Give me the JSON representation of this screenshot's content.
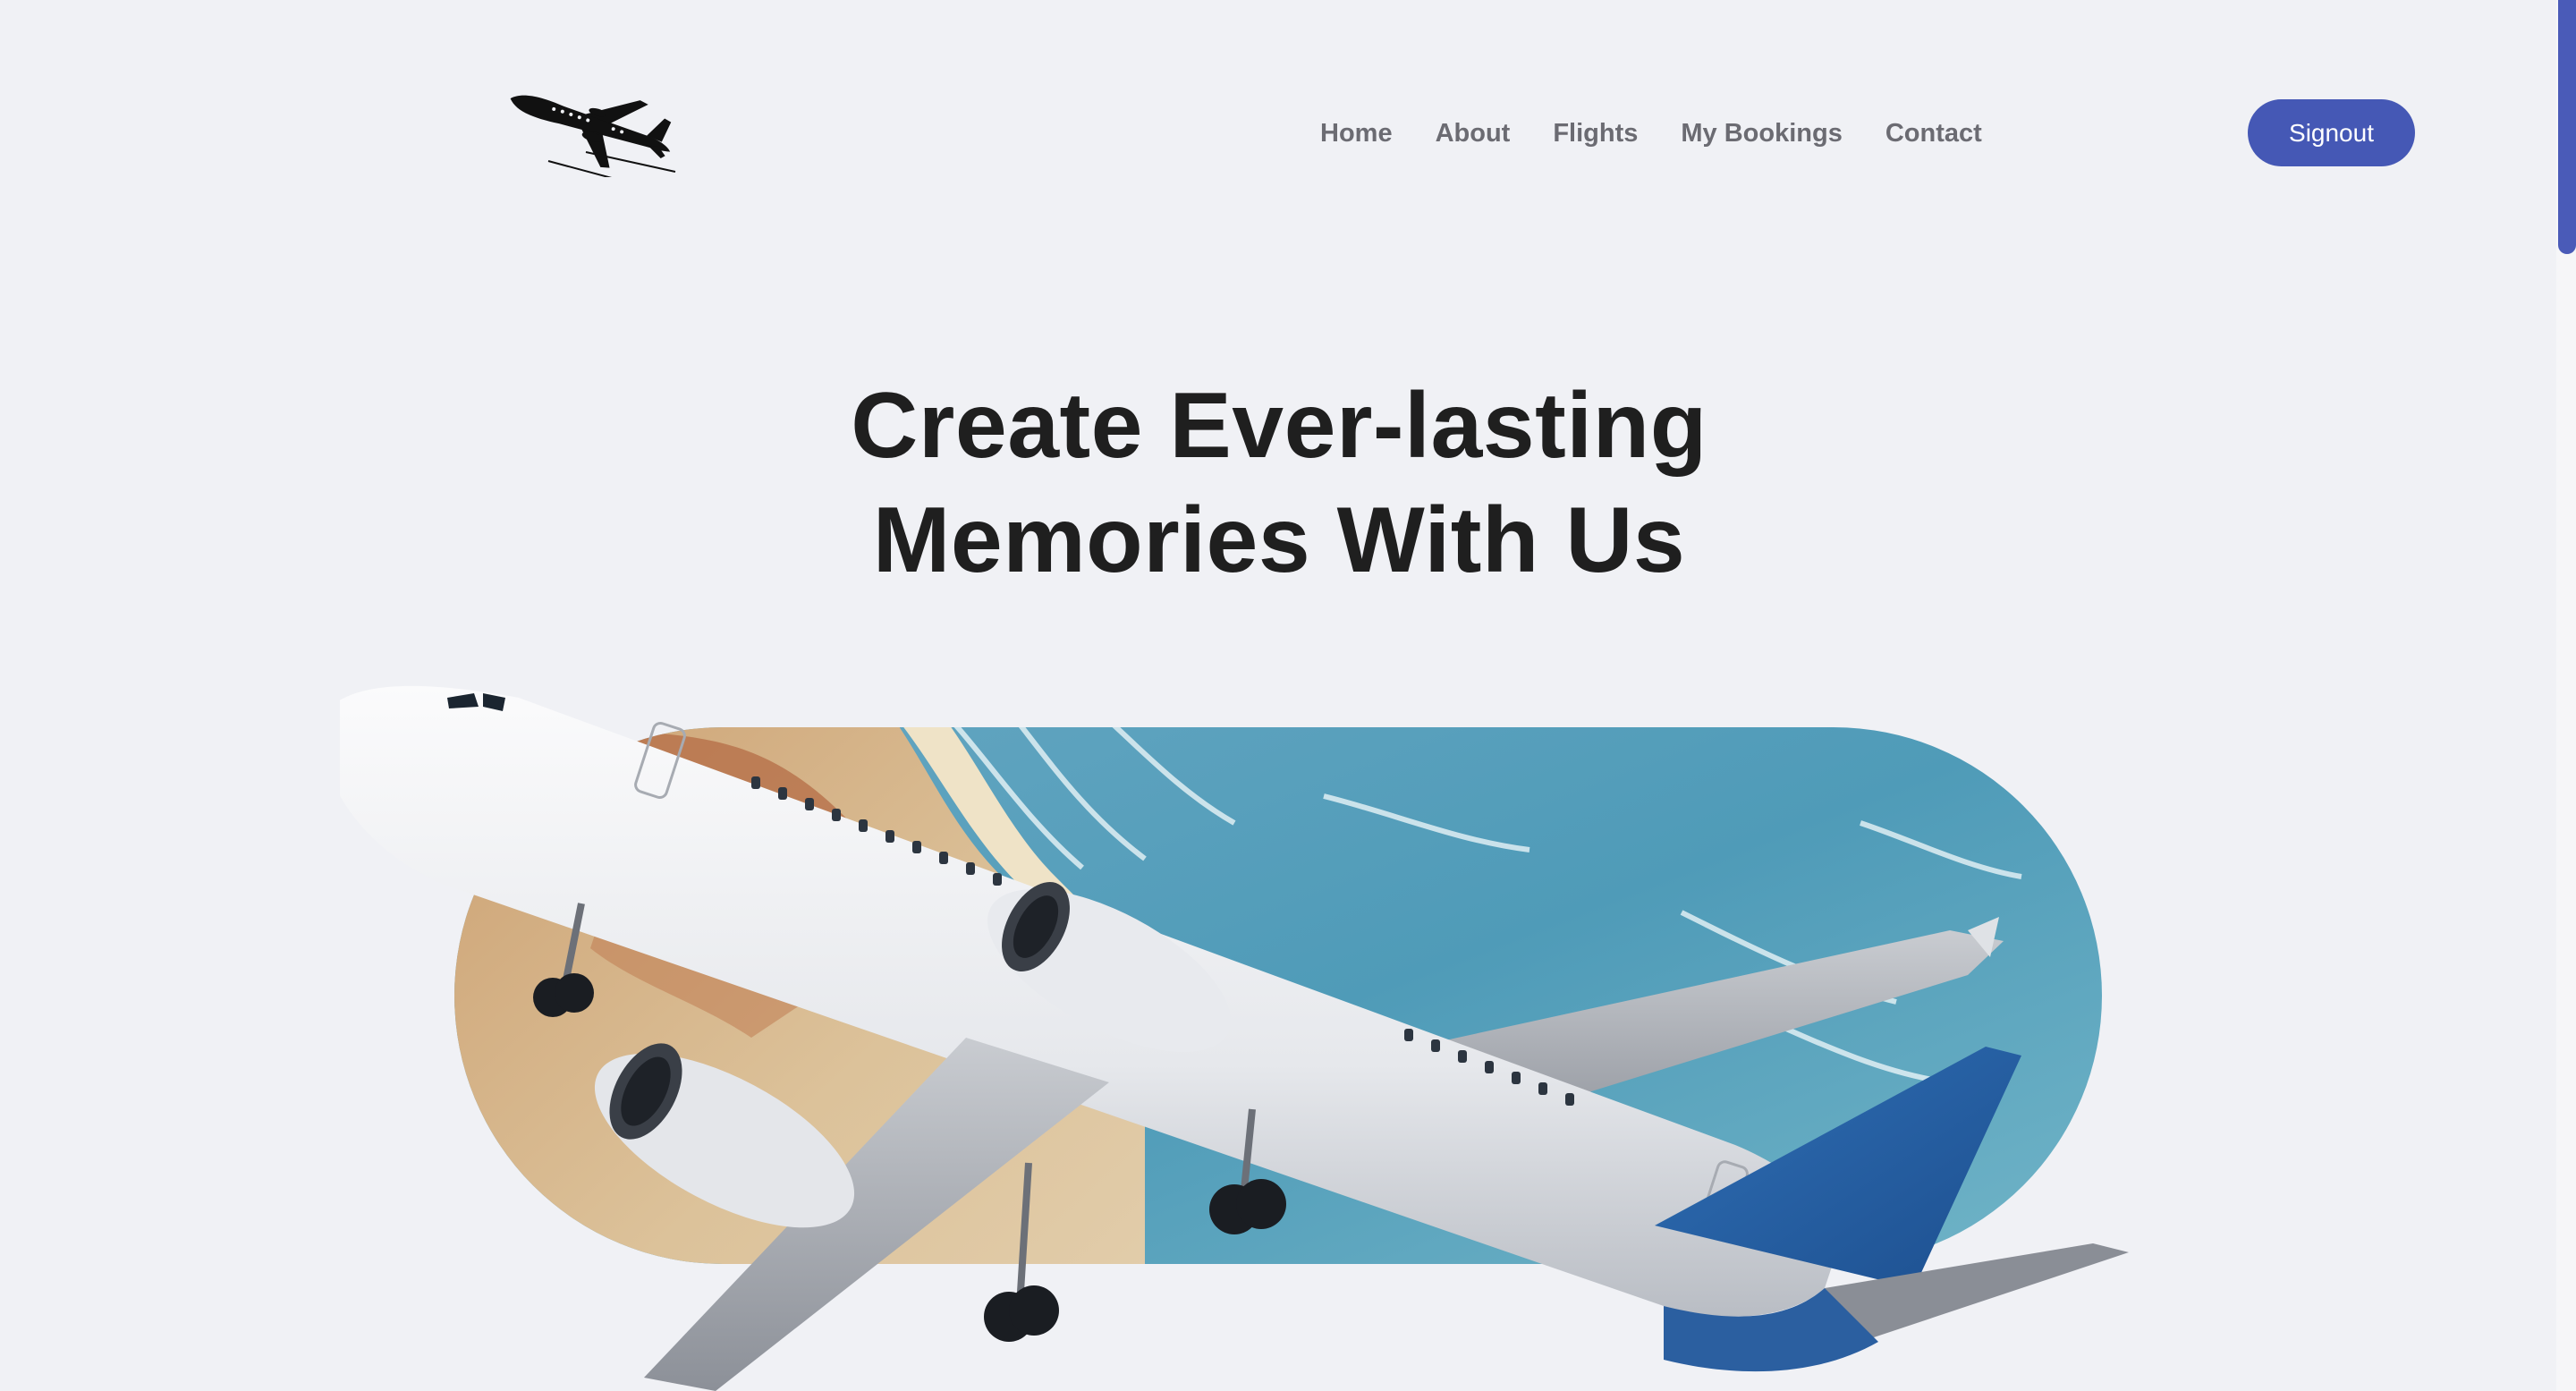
{
  "nav": {
    "items": [
      {
        "label": "Home"
      },
      {
        "label": "About"
      },
      {
        "label": "Flights"
      },
      {
        "label": "My Bookings"
      },
      {
        "label": "Contact"
      }
    ],
    "signout_label": "Signout"
  },
  "hero": {
    "title_line1": "Create Ever-lasting",
    "title_line2": "Memories With Us"
  },
  "colors": {
    "background": "#f0f1f5",
    "accent": "#4558b5",
    "heading": "#1f1f1f",
    "nav_text": "#6b6b72"
  },
  "icons": {
    "logo": "airplane-silhouette-icon"
  }
}
